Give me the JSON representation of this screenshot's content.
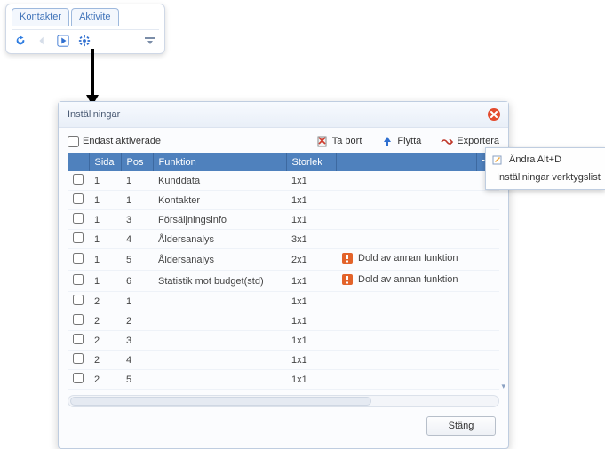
{
  "tabs": {
    "items": [
      {
        "label": "Kontakter"
      },
      {
        "label": "Aktivite"
      }
    ]
  },
  "dialog": {
    "title": "Inställningar",
    "toolbar": {
      "only_active_label": "Endast aktiverade",
      "delete_label": "Ta bort",
      "move_label": "Flytta",
      "export_label": "Exportera"
    },
    "columns": {
      "sida": "Sida",
      "pos": "Pos",
      "funktion": "Funktion",
      "storlek": "Storlek"
    },
    "rows": [
      {
        "sida": "1",
        "pos": "1",
        "funktion": "Kunddata",
        "storlek": "1x1",
        "note": ""
      },
      {
        "sida": "1",
        "pos": "1",
        "funktion": "Kontakter",
        "storlek": "1x1",
        "note": ""
      },
      {
        "sida": "1",
        "pos": "3",
        "funktion": "Försäljningsinfo",
        "storlek": "1x1",
        "note": ""
      },
      {
        "sida": "1",
        "pos": "4",
        "funktion": "Åldersanalys",
        "storlek": "3x1",
        "note": ""
      },
      {
        "sida": "1",
        "pos": "5",
        "funktion": "Åldersanalys",
        "storlek": "2x1",
        "note": "Dold av annan funktion"
      },
      {
        "sida": "1",
        "pos": "6",
        "funktion": "Statistik mot budget(std)",
        "storlek": "1x1",
        "note": "Dold av annan funktion"
      },
      {
        "sida": "2",
        "pos": "1",
        "funktion": "",
        "storlek": "1x1",
        "note": ""
      },
      {
        "sida": "2",
        "pos": "2",
        "funktion": "",
        "storlek": "1x1",
        "note": ""
      },
      {
        "sida": "2",
        "pos": "3",
        "funktion": "",
        "storlek": "1x1",
        "note": ""
      },
      {
        "sida": "2",
        "pos": "4",
        "funktion": "",
        "storlek": "1x1",
        "note": ""
      },
      {
        "sida": "2",
        "pos": "5",
        "funktion": "",
        "storlek": "1x1",
        "note": ""
      }
    ],
    "close_button": "Stäng"
  },
  "contextMenu": {
    "edit_label": "Ändra Alt+D",
    "settings_label": "Inställningar verktygslist"
  }
}
